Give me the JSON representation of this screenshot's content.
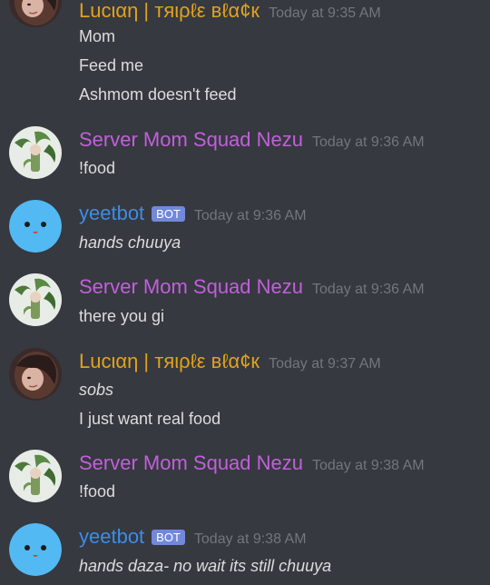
{
  "colors": {
    "background": "#36393f",
    "text": "#dcddde",
    "timestamp": "#72767d",
    "lucian_name": "#e2a21d",
    "nezu_name": "#c25fdc",
    "yeetbot_name": "#3c8ce8",
    "bot_badge": "#7289da",
    "bot_avatar": "#52b9f3"
  },
  "messages": [
    {
      "author": "Lucιαη | тяιρℓε вℓα¢к",
      "timestamp": "Today at 9:35 AM",
      "avatar": "girl-avatar",
      "lines": [
        "Mom",
        "Feed me",
        "Ashmom doesn't feed"
      ]
    },
    {
      "author": "Server Mom Squad Nezu",
      "timestamp": "Today at 9:36 AM",
      "avatar": "plant-avatar",
      "lines": [
        "!food"
      ]
    },
    {
      "author": "yeetbot",
      "badge": "BOT",
      "timestamp": "Today at 9:36 AM",
      "avatar": "bot-face-avatar",
      "lines": [
        "hands chuuya"
      ]
    },
    {
      "author": "Server Mom Squad Nezu",
      "timestamp": "Today at 9:36 AM",
      "avatar": "plant-avatar",
      "lines": [
        "there you gi"
      ]
    },
    {
      "author": "Lucιαη | тяιρℓε вℓα¢к",
      "timestamp": "Today at 9:37 AM",
      "avatar": "girl-avatar",
      "lines": [
        "sobs",
        "I just want real food"
      ]
    },
    {
      "author": "Server Mom Squad Nezu",
      "timestamp": "Today at 9:38 AM",
      "avatar": "plant-avatar",
      "lines": [
        "!food"
      ]
    },
    {
      "author": "yeetbot",
      "badge": "BOT",
      "timestamp": "Today at 9:38 AM",
      "avatar": "bot-face-avatar",
      "lines": [
        "hands daza- no wait its still chuuya"
      ]
    }
  ]
}
